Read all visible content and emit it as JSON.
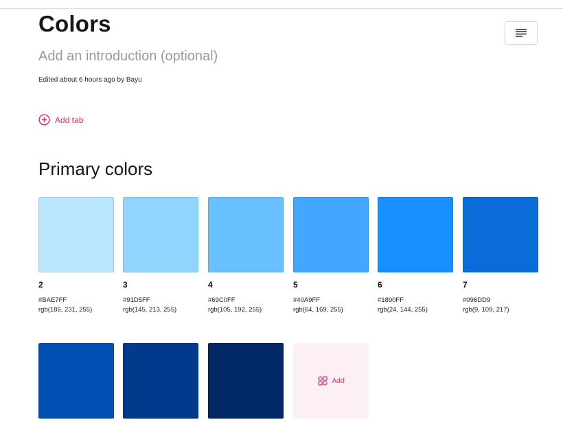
{
  "header": {
    "title": "Colors",
    "intro_placeholder": "Add an introduction (optional)",
    "edited": "Edited about 6 hours ago by Bayu",
    "toc_icon": "menu-lines-icon"
  },
  "tabs": {
    "add_tab_label": "Add tab",
    "add_tab_icon": "plus-circle-icon"
  },
  "section": {
    "title": "Primary colors"
  },
  "colors": [
    {
      "name": "2",
      "hex": "#BAE7FF",
      "rgb": "rgb(186, 231, 255)"
    },
    {
      "name": "3",
      "hex": "#91D5FF",
      "rgb": "rgb(145, 213, 255)"
    },
    {
      "name": "4",
      "hex": "#69C0FF",
      "rgb": "rgb(105, 192, 255)"
    },
    {
      "name": "5",
      "hex": "#40A9FF",
      "rgb": "rgb(64, 169, 255)"
    },
    {
      "name": "6",
      "hex": "#1890FF",
      "rgb": "rgb(24, 144, 255)"
    },
    {
      "name": "7",
      "hex": "#096DD9",
      "rgb": "rgb(9, 109, 217)"
    },
    {
      "hex_fill": "#0050B3"
    },
    {
      "hex_fill": "#003A8C"
    },
    {
      "hex_fill": "#002766"
    }
  ],
  "add_swatch": {
    "label": "Add",
    "icon": "shapes-icon"
  },
  "accent": "#E0306B"
}
